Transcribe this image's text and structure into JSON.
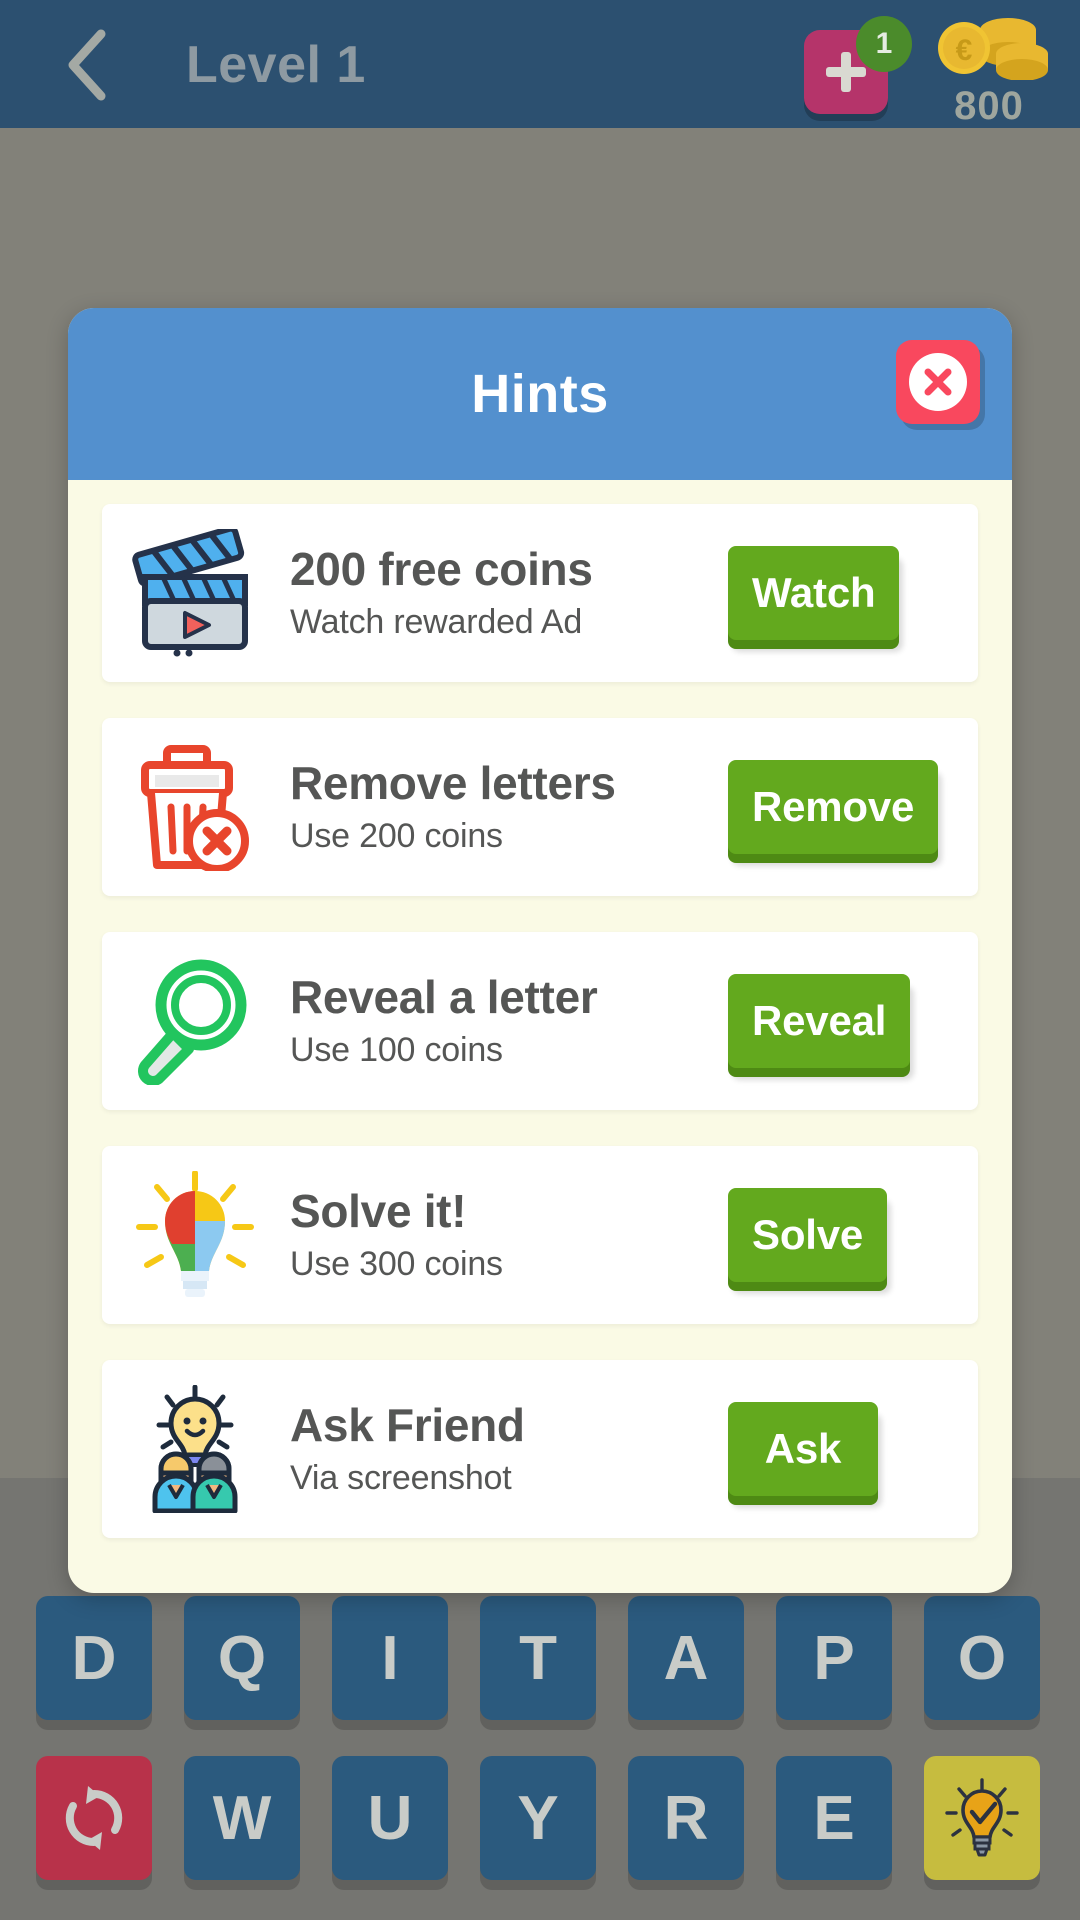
{
  "topbar": {
    "back_icon": "chevron-left-icon",
    "title": "Level 1",
    "plus_icon": "plus-icon",
    "plus_badge": "1",
    "coin_icon": "coin-stack-icon",
    "coin_amount": "800",
    "bg_color": "#2C5070",
    "plus_color": "#B5346A",
    "badge_color": "#4B8B2B"
  },
  "dialog": {
    "title": "Hints",
    "header_color": "#5390CE",
    "body_color": "#FAFAE5",
    "close_icon": "close-x-icon",
    "close_color": "#F9485E",
    "button_color": "#63A91E",
    "hints": [
      {
        "icon": "movie-clapper-icon",
        "title": "200 free coins",
        "subtitle": "Watch rewarded Ad",
        "button": "Watch"
      },
      {
        "icon": "trash-delete-icon",
        "title": "Remove letters",
        "subtitle": "Use 200 coins",
        "button": "Remove"
      },
      {
        "icon": "magnifier-icon",
        "title": "Reveal a letter",
        "subtitle": "Use 100 coins",
        "button": "Reveal"
      },
      {
        "icon": "puzzle-lightbulb-icon",
        "title": "Solve it!",
        "subtitle": "Use 300 coins",
        "button": "Solve"
      },
      {
        "icon": "friends-idea-icon",
        "title": "Ask Friend",
        "subtitle": "Via screenshot",
        "button": "Ask"
      }
    ]
  },
  "keyboard": {
    "key_color": "#2B5A7E",
    "shuffle_color": "#B8324A",
    "bulb_color": "#C6BC3F",
    "row1": [
      "D",
      "Q",
      "I",
      "T",
      "A",
      "P",
      "O"
    ],
    "row2_letters": [
      "W",
      "U",
      "Y",
      "R",
      "E"
    ],
    "shuffle_icon": "shuffle-icon",
    "bulb_icon": "lightbulb-hint-icon"
  }
}
